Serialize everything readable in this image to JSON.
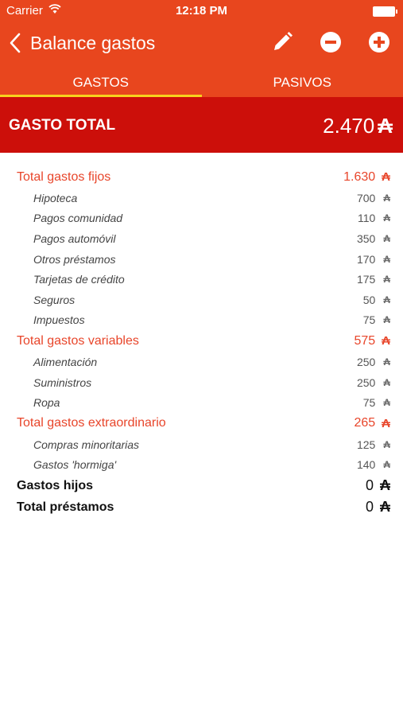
{
  "status_bar": {
    "carrier": "Carrier",
    "time": "12:18 PM"
  },
  "nav": {
    "title": "Balance gastos"
  },
  "tabs": [
    {
      "label": "GASTOS",
      "active": true
    },
    {
      "label": "PASIVOS",
      "active": false
    }
  ],
  "total": {
    "label": "GASTO TOTAL",
    "amount": "2.470",
    "currency": "₳"
  },
  "groups": [
    {
      "label": "Total gastos fijos",
      "value": "1.630",
      "currency": "₳",
      "items": [
        {
          "label": "Hipoteca",
          "value": "700",
          "currency": "₳"
        },
        {
          "label": "Pagos comunidad",
          "value": "110",
          "currency": "₳"
        },
        {
          "label": "Pagos automóvil",
          "value": "350",
          "currency": "₳"
        },
        {
          "label": "Otros préstamos",
          "value": "170",
          "currency": "₳"
        },
        {
          "label": "Tarjetas de crédito",
          "value": "175",
          "currency": "₳"
        },
        {
          "label": "Seguros",
          "value": "50",
          "currency": "₳"
        },
        {
          "label": "Impuestos",
          "value": "75",
          "currency": "₳"
        }
      ]
    },
    {
      "label": "Total gastos variables",
      "value": "575",
      "currency": "₳",
      "items": [
        {
          "label": "Alimentación",
          "value": "250",
          "currency": "₳"
        },
        {
          "label": "Suministros",
          "value": "250",
          "currency": "₳"
        },
        {
          "label": "Ropa",
          "value": "75",
          "currency": "₳"
        }
      ]
    },
    {
      "label": "Total gastos extraordinario",
      "value": "265",
      "currency": "₳",
      "items": [
        {
          "label": "Compras minoritarias",
          "value": "125",
          "currency": "₳"
        },
        {
          "label": "Gastos 'hormiga'",
          "value": "140",
          "currency": "₳"
        }
      ]
    }
  ],
  "plain_rows": [
    {
      "label": "Gastos hijos",
      "value": "0",
      "currency": "₳"
    },
    {
      "label": "Total préstamos",
      "value": "0",
      "currency": "₳"
    }
  ],
  "colors": {
    "header": "#e8461e",
    "total_band": "#cc0f0a",
    "accent_text": "#e8452a",
    "tab_indicator": "#f7d21e"
  }
}
